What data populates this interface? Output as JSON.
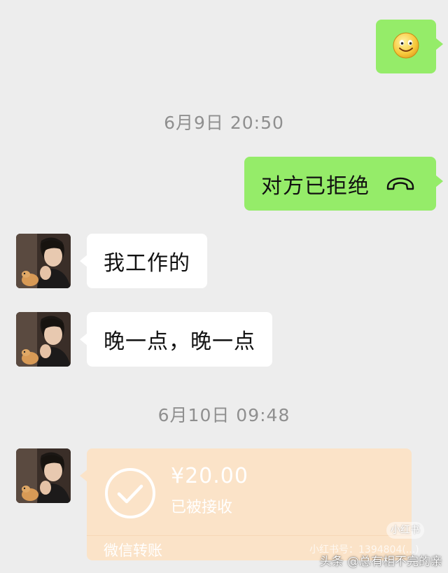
{
  "messages": {
    "emoji_bubble": {
      "icon": "smiley-emoji-icon"
    },
    "timestamp_1": "6月9日 20:50",
    "call_bubble": {
      "text": "对方已拒绝",
      "icon": "phone-hangup-icon"
    },
    "recv_1": "我工作的",
    "recv_2": "晚一点，晚一点",
    "timestamp_2": "6月10日 09:48"
  },
  "transfer": {
    "amount": "¥20.00",
    "status": "已被接收",
    "label": "微信转账",
    "icon": "check-circle-icon"
  },
  "overlay": {
    "xhs_badge": "小红书",
    "xhs_id": "小红书号：1394804(...)",
    "watermark": "头条 @总有相不完的亲"
  },
  "colors": {
    "background": "#ededed",
    "sent_bubble": "#95ec69",
    "received_bubble": "#ffffff",
    "transfer_card": "#fbe3c8",
    "timestamp_text": "#8f8f8f"
  }
}
